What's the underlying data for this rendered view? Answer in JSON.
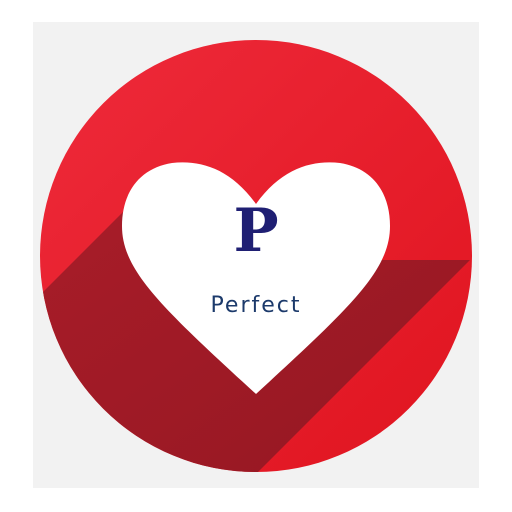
{
  "logo": {
    "monogram": "P",
    "wordmark": "Perfect",
    "colors": {
      "circle": "#e41c2b",
      "circle_shadow": "#9c1a26",
      "heart": "#ffffff",
      "monogram": "#1f1f73",
      "wordmark": "#1c3a6b",
      "background": "#f2f2f2"
    },
    "icon": "heart-icon"
  }
}
